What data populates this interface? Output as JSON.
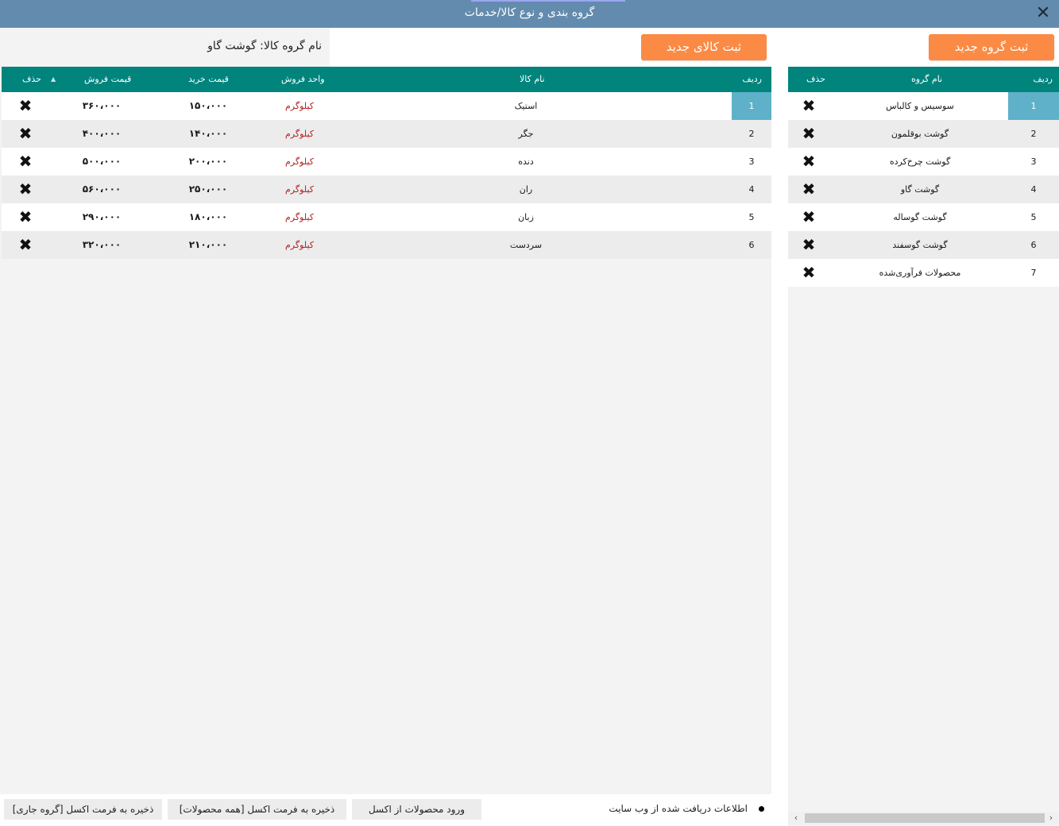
{
  "window": {
    "title": "گروه بندی و نوع کالا/خدمات",
    "close_icon": "✕"
  },
  "groups_panel": {
    "add_button": "ثبت گروه جدید",
    "columns": {
      "row": "ردیف",
      "name": "نام گروه",
      "delete": "حذف"
    },
    "rows": [
      {
        "row": "1",
        "name": "سوسیس و کالباس"
      },
      {
        "row": "2",
        "name": "گوشت بوقلمون"
      },
      {
        "row": "3",
        "name": "گوشت چرخ‌کرده"
      },
      {
        "row": "4",
        "name": "گوشت گاو"
      },
      {
        "row": "5",
        "name": "گوشت گوساله"
      },
      {
        "row": "6",
        "name": "گوشت گوسفند"
      },
      {
        "row": "7",
        "name": "محصولات فرآوری‌شده"
      }
    ],
    "selected_row": "1"
  },
  "products_panel": {
    "add_button": "ثبت کالای جدید",
    "group_label": "نام گروه کالا: گوشت گاو",
    "columns": {
      "row": "ردیف",
      "name": "نام کالا",
      "unit": "واحد فروش",
      "buy": "قیمت خرید",
      "sell": "قیمت فروش",
      "delete": "حذف"
    },
    "rows": [
      {
        "row": "1",
        "name": "استیک",
        "unit": "کیلوگرم",
        "buy": "۱۵۰،۰۰۰",
        "sell": "۳۶۰،۰۰۰"
      },
      {
        "row": "2",
        "name": "جگر",
        "unit": "کیلوگرم",
        "buy": "۱۴۰،۰۰۰",
        "sell": "۴۰۰،۰۰۰"
      },
      {
        "row": "3",
        "name": "دنده",
        "unit": "کیلوگرم",
        "buy": "۲۰۰،۰۰۰",
        "sell": "۵۰۰،۰۰۰"
      },
      {
        "row": "4",
        "name": "ران",
        "unit": "کیلوگرم",
        "buy": "۲۵۰،۰۰۰",
        "sell": "۵۶۰،۰۰۰"
      },
      {
        "row": "5",
        "name": "زبان",
        "unit": "کیلوگرم",
        "buy": "۱۸۰،۰۰۰",
        "sell": "۲۹۰،۰۰۰"
      },
      {
        "row": "6",
        "name": "سردست",
        "unit": "کیلوگرم",
        "buy": "۲۱۰،۰۰۰",
        "sell": "۳۲۰،۰۰۰"
      }
    ],
    "selected_row": "1"
  },
  "footer": {
    "status_text": "اطلاعات دریافت شده از وب سایت",
    "import_button": "ورود محصولات از اکسل",
    "export_all_button": "ذخیره به فرمت اکسل [همه محصولات]",
    "export_group_button": "ذخیره به فرمت اکسل [گروه جاری]"
  },
  "icons": {
    "delete": "delete-x-icon",
    "sort": "sort-up-icon",
    "close": "close-icon"
  },
  "colors": {
    "titlebar": "#638bae",
    "header": "#00847c",
    "accent_button": "#fb8a45",
    "selection": "#5eb1c8",
    "unit_text": "#b22222"
  }
}
